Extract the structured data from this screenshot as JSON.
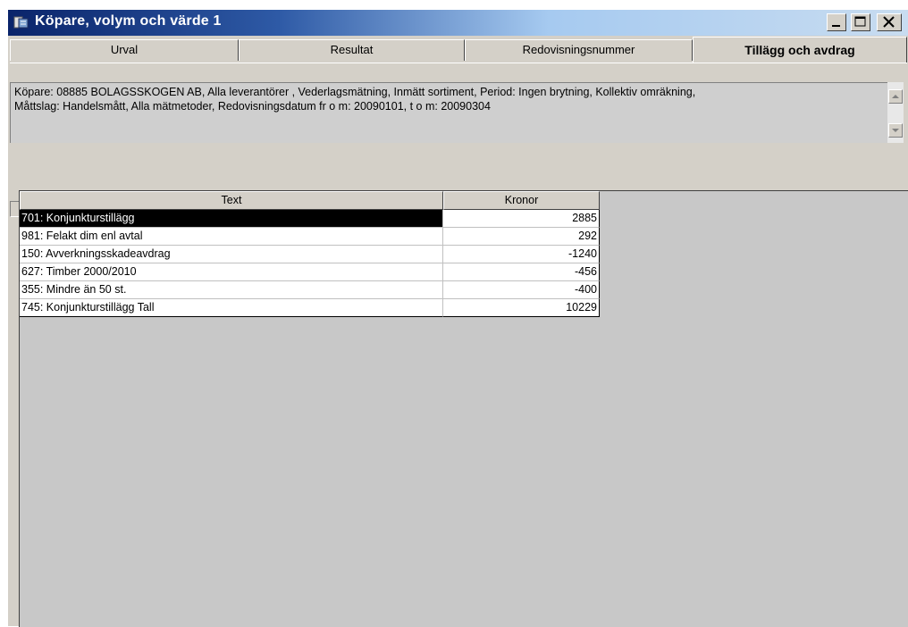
{
  "window": {
    "title": "Köpare, volym och värde 1",
    "titlebar_colors": [
      "#0a246a",
      "#a6caf0"
    ]
  },
  "tabs": [
    {
      "label": "Urval",
      "active": false
    },
    {
      "label": "Resultat",
      "active": false
    },
    {
      "label": "Redovisningsnummer",
      "active": false
    },
    {
      "label": "Tillägg och avdrag",
      "active": true
    }
  ],
  "summary": {
    "line1": "Köpare: 08885 BOLAGSSKOGEN AB, Alla leverantörer , Vederlagsmätning, Inmätt sortiment, Period: Ingen brytning, Kollektiv omräkning,",
    "line2": "Måttslag: Handelsmått, Alla mätmetoder, Redovisningsdatum  fr o m: 20090101, t o m: 20090304"
  },
  "table": {
    "columns": [
      "Text",
      "Kronor"
    ],
    "rows": [
      {
        "text": "701: Konjunkturstillägg",
        "kronor": "2885",
        "selected": true
      },
      {
        "text": "981: Felakt dim enl avtal",
        "kronor": "292",
        "selected": false
      },
      {
        "text": "150: Avverkningsskadeavdrag",
        "kronor": "-1240",
        "selected": false
      },
      {
        "text": "627: Timber 2000/2010",
        "kronor": "-456",
        "selected": false
      },
      {
        "text": "355: Mindre än 50 st.",
        "kronor": "-400",
        "selected": false
      },
      {
        "text": "745: Konjunkturstillägg Tall",
        "kronor": "10229",
        "selected": false
      }
    ]
  },
  "icons": {
    "app": "app-window-icon",
    "minimize": "minimize-icon",
    "maximize": "maximize-icon",
    "close": "close-icon",
    "scroll_up": "arrow-up-icon",
    "scroll_down": "arrow-down-icon"
  }
}
